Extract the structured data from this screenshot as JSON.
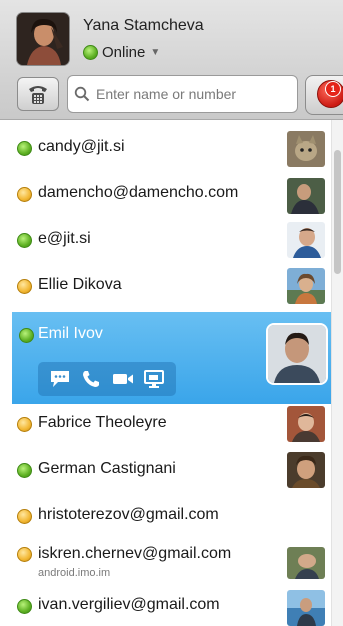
{
  "user": {
    "name": "Yana Stamcheva",
    "status": "Online",
    "status_icon": "green-status-dot",
    "dropdown_icon": "chevron-down-icon"
  },
  "search": {
    "placeholder": "Enter name or number",
    "icon": "search-icon"
  },
  "dialpad": {
    "icon": "dialpad-phone-icon"
  },
  "notifications": {
    "count": "1",
    "icon": "notification-icon"
  },
  "colors": {
    "online": "#5fb124",
    "away": "#f2b733",
    "selected": "#49afee",
    "header": "#d6d6d6"
  },
  "contacts": [
    {
      "name": "candy@jit.si",
      "status": "online",
      "avatar": "cat-photo"
    },
    {
      "name": "damencho@damencho.com",
      "status": "away",
      "avatar": "man-photo"
    },
    {
      "name": "e@jit.si",
      "status": "online",
      "avatar": "man-photo"
    },
    {
      "name": "Ellie Dikova",
      "status": "away",
      "avatar": "woman-photo"
    },
    {
      "name": "Emil Ivov",
      "status": "online",
      "avatar": "man-photo",
      "selected": true
    },
    {
      "name": "Fabrice Theoleyre",
      "status": "away",
      "avatar": "man-photo"
    },
    {
      "name": "German Castignani",
      "status": "online",
      "avatar": "man-photo"
    },
    {
      "name": "hristoterezov@gmail.com",
      "status": "away",
      "avatar": null
    },
    {
      "name": "iskren.chernev@gmail.com",
      "subtitle": "android.imo.im",
      "status": "away",
      "avatar": "man-photo"
    },
    {
      "name": "ivan.vergiliev@gmail.com",
      "status": "online",
      "avatar": "man-photo"
    }
  ],
  "selected_actions": [
    "chat-icon",
    "call-icon",
    "video-call-icon",
    "desktop-share-icon"
  ]
}
